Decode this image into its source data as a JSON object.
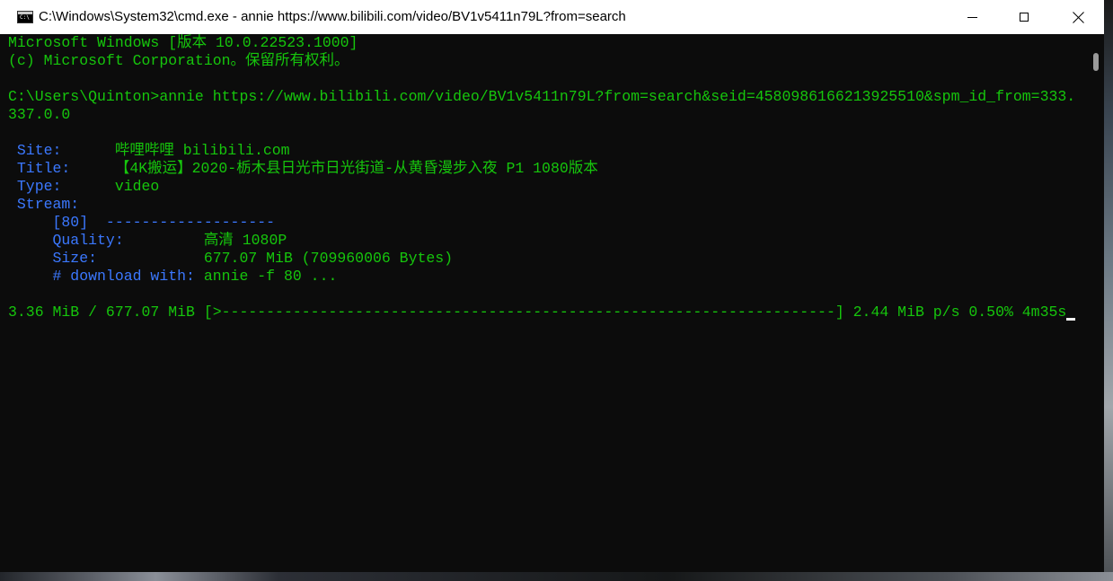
{
  "window": {
    "title": "C:\\Windows\\System32\\cmd.exe - annie  https://www.bilibili.com/video/BV1v5411n79L?from=search",
    "icon": "cmd-app-icon"
  },
  "controls": {
    "minimize_icon": "minimize-icon",
    "maximize_icon": "maximize-icon",
    "close_icon": "close-icon"
  },
  "console": {
    "header1": "Microsoft Windows [版本 10.0.22523.1000]",
    "header2": "(c) Microsoft Corporation。保留所有权利。",
    "command_line1": "C:\\Users\\Quinton>annie https://www.bilibili.com/video/BV1v5411n79L?from=search&seid=4580986166213925510&spm_id_from=333.",
    "command_line2": "337.0.0",
    "site_label": " Site:      ",
    "site_value": "哔哩哔哩 bilibili.com",
    "title_label": " Title:     ",
    "title_value": "【4K搬运】2020-栃木县日光市日光街道-从黄昏漫步入夜 P1 1080版本",
    "type_label": " Type:      ",
    "type_value": "video",
    "stream_label": " Stream:",
    "stream_id": "     [80]  ",
    "stream_divider": "-------------------",
    "quality_label": "     Quality:         ",
    "quality_value": "高清 1080P",
    "size_label": "     Size:            ",
    "size_value": "677.07 MiB (709960006 Bytes)",
    "download_label": "     # download with: ",
    "download_value": "annie -f 80 ...",
    "progress": "3.36 MiB / 677.07 MiB [>---------------------------------------------------------------------] 2.44 MiB p/s 0.50% 4m35s"
  },
  "colors": {
    "console_bg": "#0c0c0c",
    "text_green": "#16c60c",
    "text_blue": "#3b78ff",
    "titlebar_bg": "#ffffff"
  }
}
